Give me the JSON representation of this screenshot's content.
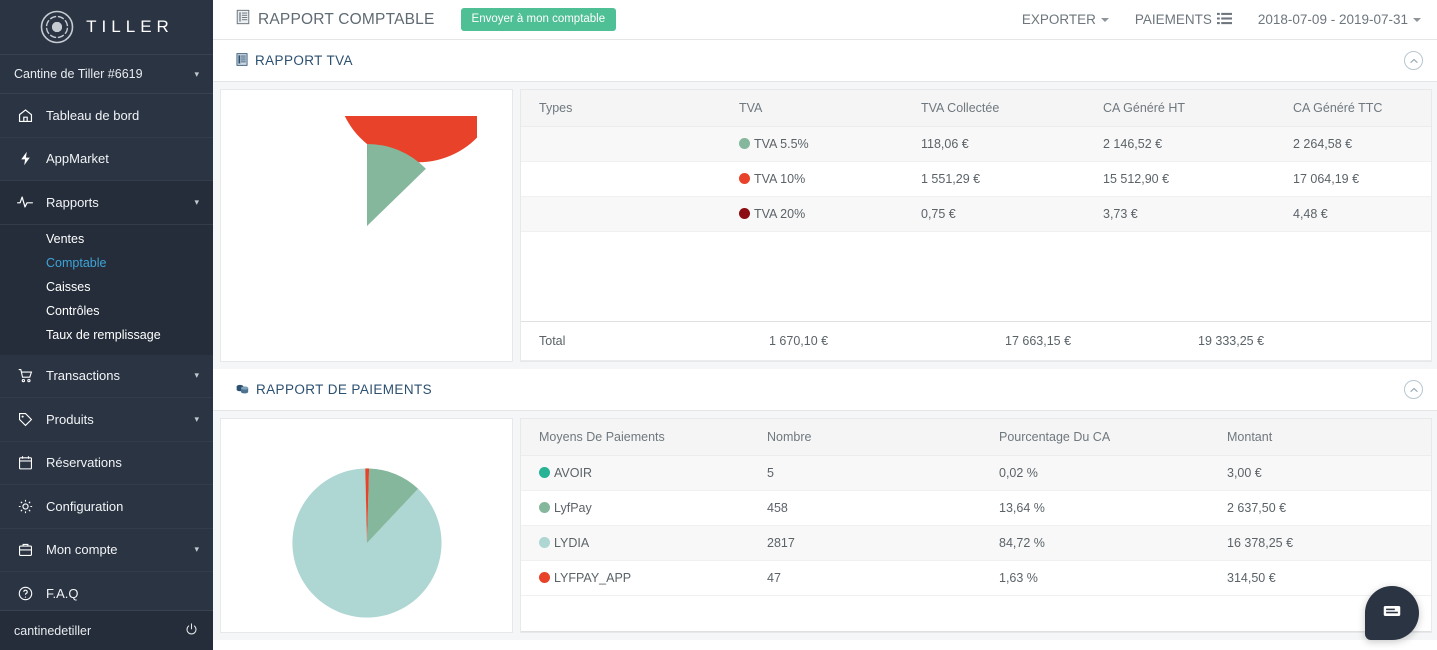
{
  "sidebar": {
    "brand": "TILLER",
    "store": "Cantine de Tiller #6619",
    "items": [
      {
        "label": "Tableau de bord",
        "icon": "home-icon",
        "caret": false
      },
      {
        "label": "AppMarket",
        "icon": "bolt-icon",
        "caret": false
      },
      {
        "label": "Rapports",
        "icon": "pulse-icon",
        "caret": true
      }
    ],
    "rapports_sub": [
      {
        "label": "Ventes",
        "selected": false
      },
      {
        "label": "Comptable",
        "selected": true
      },
      {
        "label": "Caisses",
        "selected": false
      },
      {
        "label": "Contrôles",
        "selected": false
      },
      {
        "label": "Taux de remplissage",
        "selected": false
      }
    ],
    "items2": [
      {
        "label": "Transactions",
        "icon": "cart-icon",
        "caret": true
      },
      {
        "label": "Produits",
        "icon": "tag-icon",
        "caret": true
      },
      {
        "label": "Réservations",
        "icon": "calendar-icon",
        "caret": false
      },
      {
        "label": "Configuration",
        "icon": "gear-icon",
        "caret": false
      },
      {
        "label": "Mon compte",
        "icon": "briefcase-icon",
        "caret": true
      },
      {
        "label": "F.A.Q",
        "icon": "question-icon",
        "caret": false
      }
    ],
    "footer_user": "cantinedetiller",
    "footer_icon": "power-icon",
    "accent": "#3ea4d8",
    "background": "#2b3443"
  },
  "topbar": {
    "title": "RAPPORT COMPTABLE",
    "title_icon": "report-icon",
    "send_button": "Envoyer à mon comptable",
    "send_button_color": "#4fbf95",
    "export_label": "EXPORTER",
    "payments_label": "PAIEMENTS",
    "payments_icon": "list-icon",
    "date_range": "2018-07-09 - 2019-07-31"
  },
  "tva_section": {
    "title": "RAPPORT TVA",
    "title_icon": "report-icon",
    "collapse_icon": "chevron-up-icon",
    "columns": [
      "Types",
      "TVA",
      "TVA Collectée",
      "CA Généré HT",
      "CA Généré TTC"
    ],
    "rows": [
      {
        "type": "",
        "tva": "TVA 5.5%",
        "color": "#84b79b",
        "collectee": "118,06 €",
        "ht": "2 146,52 €",
        "ttc": "2 264,58 €"
      },
      {
        "type": "",
        "tva": "TVA 10%",
        "color": "#e8432a",
        "collectee": "1 551,29 €",
        "ht": "15 512,90 €",
        "ttc": "17 064,19 €"
      },
      {
        "type": "",
        "tva": "TVA 20%",
        "color": "#8b0d12",
        "collectee": "0,75 €",
        "ht": "3,73 €",
        "ttc": "4,48 €"
      }
    ],
    "total": {
      "label": "Total",
      "collectee": "1 670,10 €",
      "ht": "17 663,15 €",
      "ttc": "19 333,25 €"
    }
  },
  "paiements_section": {
    "title": "RAPPORT DE PAIEMENTS",
    "title_icon": "coins-icon",
    "collapse_icon": "chevron-up-icon",
    "columns": [
      "Moyens De Paiements",
      "Nombre",
      "Pourcentage Du CA",
      "Montant"
    ],
    "rows": [
      {
        "moyen": "AVOIR",
        "color": "#27b394",
        "nombre": "5",
        "pourcentage": "0,02 %",
        "montant": "3,00 €"
      },
      {
        "moyen": "LyfPay",
        "color": "#84b79b",
        "nombre": "458",
        "pourcentage": "13,64 %",
        "montant": "2 637,50 €"
      },
      {
        "moyen": "LYDIA",
        "color": "#aed6d3",
        "nombre": "2817",
        "pourcentage": "84,72 %",
        "montant": "16 378,25 €"
      },
      {
        "moyen": "LYFPAY_APP",
        "color": "#e8432a",
        "nombre": "47",
        "pourcentage": "1,63 %",
        "montant": "314,50 €"
      }
    ]
  },
  "chart_data": [
    {
      "type": "pie",
      "title": "Répartition TVA (CA Généré HT)",
      "categories": [
        "TVA 5.5%",
        "TVA 10%",
        "TVA 20%"
      ],
      "values": [
        2146.52,
        15512.9,
        3.73
      ],
      "percents": [
        12.15,
        87.83,
        0.02
      ],
      "colors": [
        "#84b79b",
        "#e8432a",
        "#8b0d12"
      ],
      "legend": "none",
      "start_angle": 0
    },
    {
      "type": "pie",
      "title": "Répartition des moyens de paiement (Pourcentage Du CA)",
      "categories": [
        "AVOIR",
        "LyfPay",
        "LYDIA",
        "LYFPAY_APP"
      ],
      "values": [
        0.02,
        13.64,
        84.72,
        1.63
      ],
      "percents": [
        0.02,
        13.64,
        84.72,
        1.63
      ],
      "colors": [
        "#27b394",
        "#84b79b",
        "#aed6d3",
        "#e8432a"
      ],
      "legend": "none",
      "start_angle": 0
    }
  ],
  "chat": {
    "icon": "chat-icon",
    "color": "#2b3443"
  }
}
